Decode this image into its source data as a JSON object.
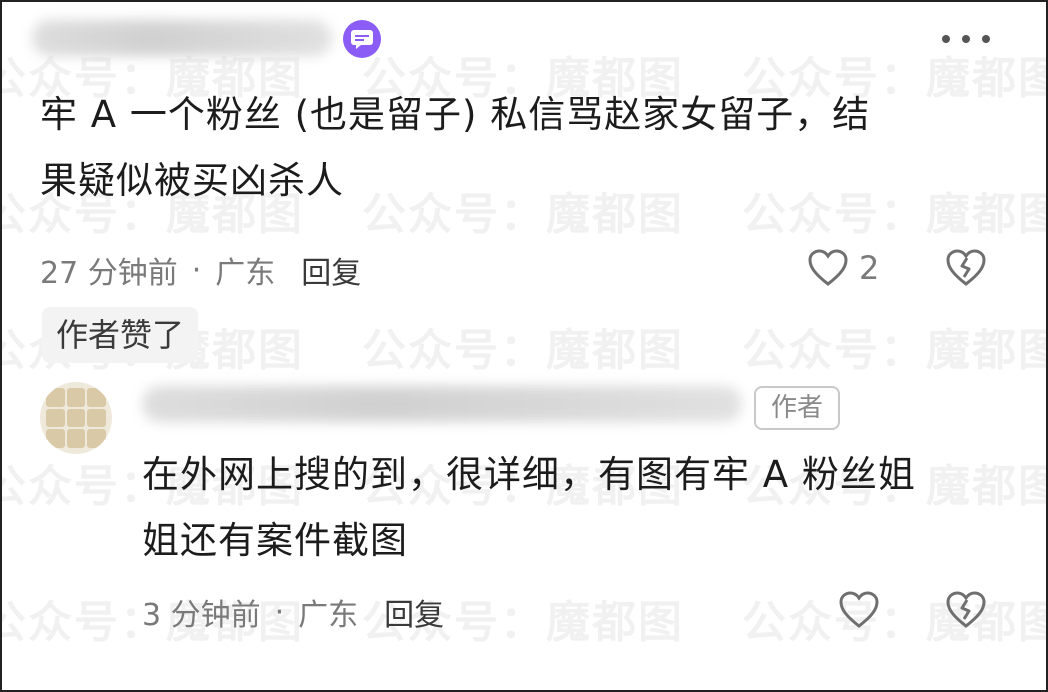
{
  "watermark": {
    "text": "公众号：魔都图"
  },
  "comments": [
    {
      "text_line1": "牢 A 一个粉丝 (也是留子) 私信骂赵家女留子，结",
      "text_line2": "果疑似被买凶杀人",
      "time": "27 分钟前",
      "separator": "·",
      "location": "广东",
      "reply_label": "回复",
      "like_count": "2",
      "author_liked_label": "作者赞了"
    },
    {
      "author_tag": "作者",
      "text_line1": "在外网上搜的到，很详细，有图有牢 A 粉丝姐",
      "text_line2": "姐还有案件截图",
      "time": "3 分钟前",
      "separator": "·",
      "location": "广东",
      "reply_label": "回复"
    }
  ],
  "icons": {
    "badge": "message-badge-icon",
    "more": "more-options-icon",
    "like": "heart-icon",
    "dislike": "broken-heart-icon"
  },
  "colors": {
    "badge_purple": "#8b5cf6",
    "meta_gray": "#7a7a7a"
  }
}
